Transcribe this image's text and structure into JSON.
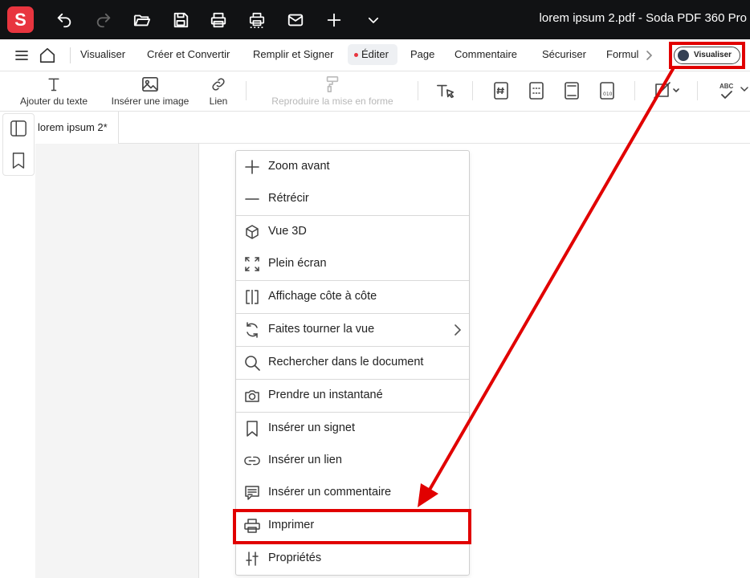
{
  "app": {
    "logo_letter": "S",
    "window_title": "lorem ipsum 2.pdf  -  Soda PDF 360 Pro",
    "accent_color": "#e8353f"
  },
  "titlebar_icons": [
    "undo-icon",
    "redo-icon",
    "open-folder-icon",
    "save-icon",
    "print-icon",
    "batch-print-icon",
    "mail-icon",
    "add-icon",
    "chevron-down-icon"
  ],
  "menubar": {
    "items": [
      "Visualiser",
      "Créer et Convertir",
      "Remplir et Signer",
      "Éditer",
      "Page",
      "Commentaire",
      "Sécuriser",
      "Formul"
    ],
    "active": "Éditer",
    "toggle_label": "Visualiser"
  },
  "toolbar": {
    "tools": [
      {
        "label": "Ajouter du texte",
        "icon": "text-icon",
        "enabled": true
      },
      {
        "label": "Insérer une image",
        "icon": "image-icon",
        "enabled": true
      },
      {
        "label": "Lien",
        "icon": "link-icon",
        "enabled": true
      },
      {
        "label": "Reproduire la mise en forme",
        "icon": "format-painter-icon",
        "enabled": false
      }
    ],
    "icon_tools": [
      "text-select-icon",
      "bates-numbering-icon",
      "header-footer-icon",
      "page-layout-icon",
      "barcode-icon",
      "shape-icon",
      "spellcheck-icon"
    ],
    "spellcheck_label": "ABC"
  },
  "document": {
    "tab_label": "lorem ipsum 2*"
  },
  "context_menu": {
    "items": [
      {
        "label": "Zoom avant",
        "icon": "plus-icon"
      },
      {
        "label": "Rétrécir",
        "icon": "minus-icon"
      },
      {
        "label": "Vue 3D",
        "icon": "cube-icon"
      },
      {
        "label": "Plein écran",
        "icon": "fullscreen-icon"
      },
      {
        "label": "Affichage côte à côte",
        "icon": "side-by-side-icon"
      },
      {
        "label": "Faites tourner la vue",
        "icon": "rotate-icon",
        "submenu": true
      },
      {
        "label": "Rechercher dans le document",
        "icon": "search-icon"
      },
      {
        "label": "Prendre un instantané",
        "icon": "camera-icon"
      },
      {
        "label": "Insérer un signet",
        "icon": "bookmark-icon"
      },
      {
        "label": "Insérer un lien",
        "icon": "link-icon"
      },
      {
        "label": "Insérer un commentaire",
        "icon": "comment-icon"
      },
      {
        "label": "Imprimer",
        "icon": "printer-icon",
        "highlighted": true
      },
      {
        "label": "Propriétés",
        "icon": "properties-icon"
      }
    ]
  },
  "annotation": {
    "color": "#e10000"
  }
}
